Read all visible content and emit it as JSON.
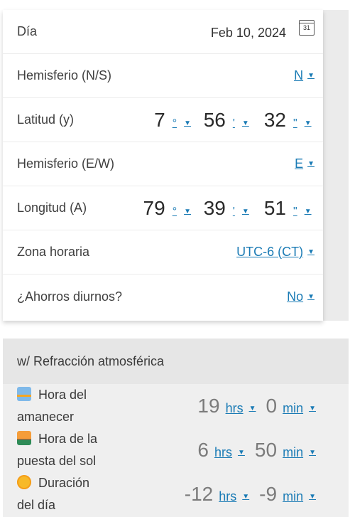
{
  "form": {
    "date": {
      "label": "Día",
      "value": "Feb 10, 2024",
      "calendar_day": "31"
    },
    "hemisphere_ns": {
      "label": "Hemisferio (N/S)",
      "value": "N"
    },
    "latitude": {
      "label": "Latitud (y)",
      "degrees": "7",
      "degrees_unit": "°",
      "minutes": "56",
      "minutes_unit": "'",
      "seconds": "32",
      "seconds_unit": "\""
    },
    "hemisphere_ew": {
      "label": "Hemisferio (E/W)",
      "value": "E"
    },
    "longitude": {
      "label": "Longitud (A)",
      "degrees": "79",
      "degrees_unit": "°",
      "minutes": "39",
      "minutes_unit": "'",
      "seconds": "51",
      "seconds_unit": "\""
    },
    "timezone": {
      "label": "Zona horaria",
      "value": "UTC-6 (CT)"
    },
    "dst": {
      "label": "¿Ahorros diurnos?",
      "value": "No"
    }
  },
  "results": {
    "header": "w/ Refracción atmosférica",
    "rows": [
      {
        "icon": "sunrise-icon",
        "line1": "Hora del",
        "line2": "amanecer",
        "hours": "19",
        "hours_unit": "hrs",
        "minutes": "0",
        "minutes_unit": "min"
      },
      {
        "icon": "sunset-icon",
        "line1": "Hora de la",
        "line2": "puesta del sol",
        "hours": "6",
        "hours_unit": "hrs",
        "minutes": "50",
        "minutes_unit": "min"
      },
      {
        "icon": "sun-icon",
        "line1": "Duración",
        "line2": "del día",
        "hours": "-12",
        "hours_unit": "hrs",
        "minutes": "-9",
        "minutes_unit": "min"
      }
    ]
  },
  "colors": {
    "link": "#1a7bb5",
    "panel_bg": "#efefef",
    "header_bg": "#e6e6e6"
  }
}
